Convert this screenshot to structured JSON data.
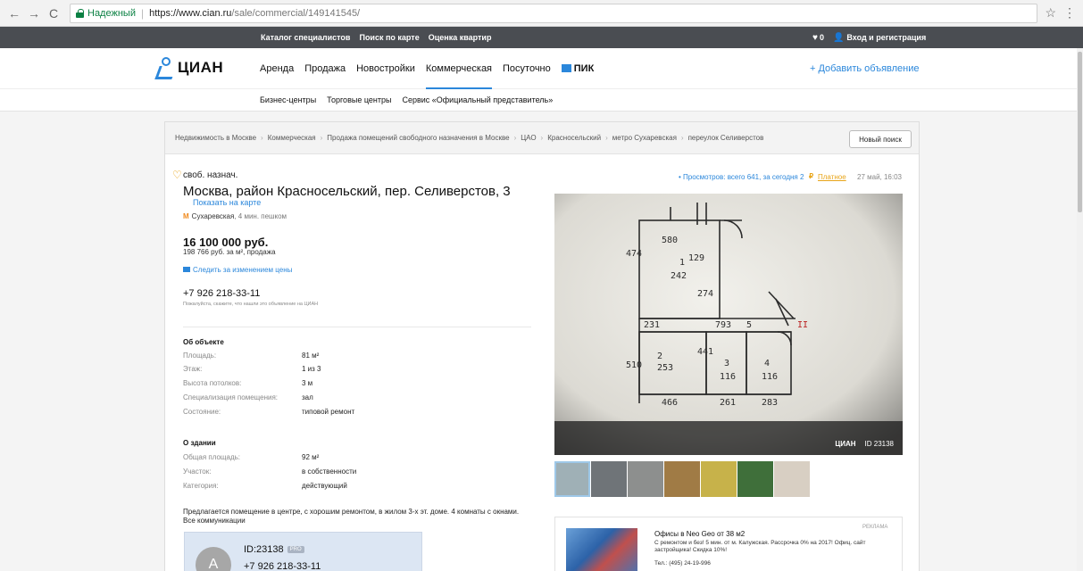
{
  "browser": {
    "secure_label": "Надежный",
    "url_host": "https://www.cian.ru",
    "url_path": "/sale/commercial/149141545/"
  },
  "topbar": {
    "links": [
      "Каталог специалистов",
      "Поиск по карте",
      "Оценка квартир"
    ],
    "favorites_count": "0",
    "login": "Вход и регистрация"
  },
  "header": {
    "logo": "ЦИАН",
    "nav": [
      "Аренда",
      "Продажа",
      "Новостройки",
      "Коммерческая",
      "Посуточно",
      "ПИК"
    ],
    "add_listing": "+ Добавить объявление"
  },
  "subnav": [
    "Бизнес-центры",
    "Торговые центры",
    "Сервис «Официальный представитель»"
  ],
  "breadcrumbs": [
    "Недвижимость в Москве",
    "Коммерческая",
    "Продажа помещений свободного назначения в Москве",
    "ЦАО",
    "Красносельский",
    "метро Сухаревская",
    "переулок Селиверстов"
  ],
  "new_search": "Новый поиск",
  "listing": {
    "type": "своб. назнач.",
    "address": "Москва, район Красносельский, пер. Селиверстов, 3",
    "show_map": "Показать на карте",
    "metro_name": "Сухаревская",
    "metro_dist": ", 4 мин. пешком",
    "price": "16 100 000 руб.",
    "price_sub": "198 766 руб. за м², продажа",
    "track_price": "Следить за изменением цены",
    "phone": "+7 926 218-33-11",
    "phone_note": "Пожалуйста, скажите, что нашли это объявление на ЦИАН",
    "views": "• Просмотров: всего 641, за сегодня 2",
    "paid": "Платное",
    "date": "27 май, 16:03",
    "description": "Предлагается помещение в центре, с хорошим ремонтом, в жилом 3-х эт. доме. 4 комнаты с окнами. Все коммуникации"
  },
  "object": {
    "title": "Об объекте",
    "rows": [
      {
        "k": "Площадь:",
        "v": "81 м²"
      },
      {
        "k": "Этаж:",
        "v": "1 из 3"
      },
      {
        "k": "Высота потолков:",
        "v": "3 м"
      },
      {
        "k": "Специализация помещения:",
        "v": "зал"
      },
      {
        "k": "Состояние:",
        "v": "типовой ремонт"
      }
    ]
  },
  "building": {
    "title": "О здании",
    "rows": [
      {
        "k": "Общая площадь:",
        "v": "92 м²"
      },
      {
        "k": "Участок:",
        "v": "в собственности"
      },
      {
        "k": "Категория:",
        "v": "действующий"
      }
    ]
  },
  "agent": {
    "avatar": "A",
    "id": "ID:23138",
    "badge": "PRO",
    "phone": "+7 926 218-33-11"
  },
  "photo": {
    "watermark": "ЦИАН",
    "watermark_id": "ID 23138",
    "plan_labels": [
      "580",
      "129",
      "474",
      "1",
      "242",
      "274",
      "231",
      "793",
      "5",
      "2",
      "253",
      "3",
      "116",
      "4",
      "116",
      "466",
      "261",
      "283",
      "510",
      "441",
      "II"
    ]
  },
  "thumbs_colors": [
    "#9fb0b6",
    "#6f7478",
    "#8d8f8e",
    "#a07b45",
    "#c7b24a",
    "#3f6f3a",
    "#d8cfc3"
  ],
  "ad": {
    "label": "РЕКЛАМА",
    "title": "Офисы в Neo Geo от 38 м2",
    "text": "С ремонтом и без! 5 мин. от м. Калужская. Рассрочка 0% на 2017! Офиц. сайт застройщика! Скидка 10%!",
    "phone": "Тел.: (495) 24-19-996"
  }
}
